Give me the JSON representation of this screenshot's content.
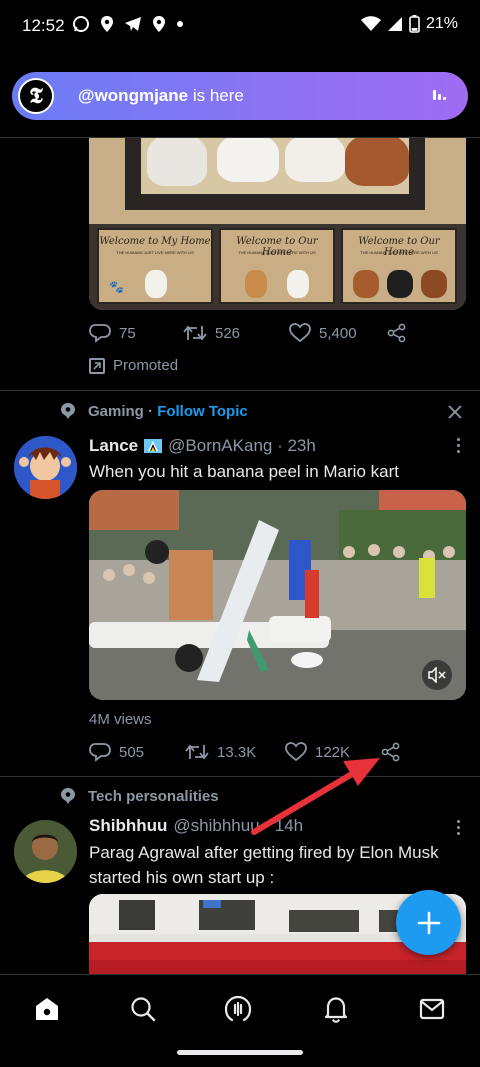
{
  "status_bar": {
    "time": "12:52",
    "battery": "21%",
    "left_icons": [
      "whatsapp-icon",
      "location-icon",
      "telegram-icon",
      "location-icon",
      "dot-icon"
    ],
    "right_icons": [
      "wifi-icon",
      "cell-signal-icon",
      "battery-icon"
    ]
  },
  "spaces_bar": {
    "avatar_letter": "𝕿",
    "username": "@wongmjane",
    "suffix": " is here"
  },
  "promoted_tweet": {
    "mat_titles": [
      "Welcome to My Home",
      "Welcome to Our Home",
      "Welcome to Our Home"
    ],
    "mat_subtitle": "THE HUMANS JUST LIVE HERE WITH US",
    "replies": "75",
    "retweets": "526",
    "likes": "5,400",
    "promoted_label": "Promoted"
  },
  "tweet1": {
    "topic": "Gaming",
    "topic_separator": "·",
    "follow_topic": "Follow Topic",
    "name": "Lance",
    "handle": "@BornAKang · 23h",
    "text": "When you hit a banana peel in Mario kart",
    "views": "4M views",
    "replies": "505",
    "retweets": "13.3K",
    "likes": "122K"
  },
  "tweet2": {
    "topic": "Tech personalities",
    "name": "Shibhhuu",
    "handle": "@shibhhuu · 14h",
    "text": "Parag Agrawal after getting fired by Elon Musk started his own start up :"
  },
  "colors": {
    "accent": "#1d9bf0",
    "background": "#000000",
    "secondary_text": "#8b98a5",
    "annotation_arrow": "#e8323a"
  },
  "bottom_nav": [
    "home-icon",
    "search-icon",
    "spaces-icon",
    "notifications-icon",
    "messages-icon"
  ]
}
